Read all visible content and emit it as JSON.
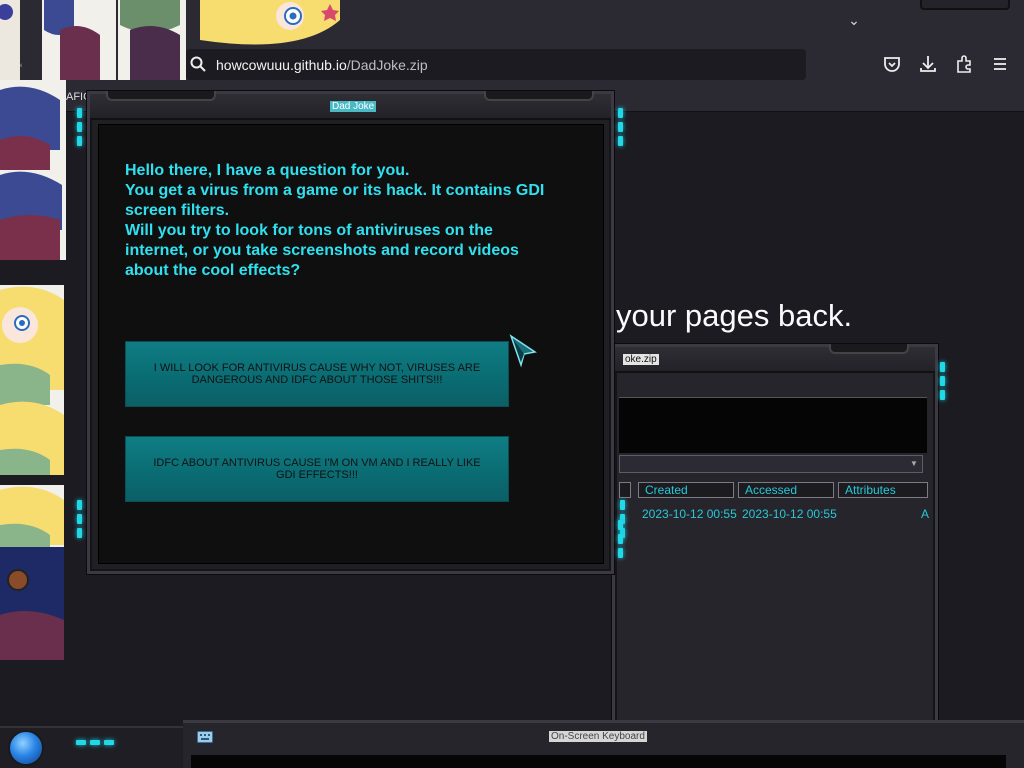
{
  "browser": {
    "url_domain": "howcowuuu.github.io",
    "url_path": "/DadJoke.zip",
    "bookmarks_fragment": "AFIC"
  },
  "page": {
    "headline": "your pages back."
  },
  "file_window": {
    "title": "oke.zip",
    "columns": [
      "Created",
      "Accessed",
      "Attributes"
    ],
    "row": {
      "created": "2023-10-12 00:55",
      "accessed": "2023-10-12 00:55",
      "attributes": "A"
    }
  },
  "dialog": {
    "title": "Dad Joke",
    "question": "Hello there, I have a question for you.\nYou get a virus from a game or its hack. It contains GDI screen filters.\nWill you try to look for tons of antiviruses on the internet, or you take screenshots and record videos about the cool effects?",
    "choices": [
      "I WILL LOOK FOR ANTIVIRUS CAUSE WHY NOT, VIRUSES ARE DANGEROUS AND IDFC ABOUT THOSE SHITS!!!",
      "IDFC ABOUT ANTIVIRUS CAUSE I'M ON VM AND I REALLY LIKE GDI EFFECTS!!!"
    ]
  },
  "keyboard": {
    "title": "On-Screen Keyboard"
  },
  "colors": {
    "neon": "#22d7e6",
    "question_text": "#2fe0ef",
    "button_teal": "#0a6b72"
  },
  "icons": [
    "search-icon",
    "pocket-icon",
    "download-icon",
    "extensions-icon",
    "menu-icon",
    "chevron-down-icon",
    "keyboard-icon",
    "start-orb-icon",
    "cursor-icon"
  ]
}
